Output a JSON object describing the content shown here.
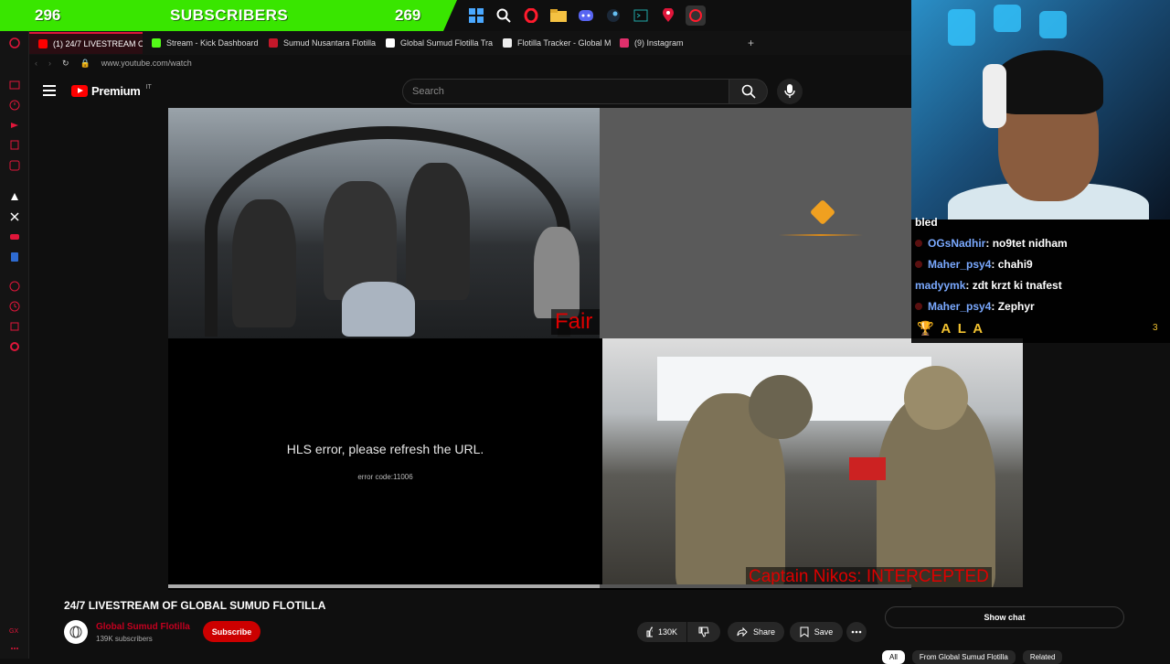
{
  "overlay": {
    "sub_count_left": "296",
    "sub_label": "SUBSCRIBERS",
    "sub_count_right": "269"
  },
  "taskbar_icons": [
    "windows-icon",
    "search-icon",
    "opera-icon",
    "folder-icon",
    "discord-icon",
    "steam-icon",
    "terminal-icon",
    "location-pin-icon",
    "opera-gx-icon"
  ],
  "tabs": [
    {
      "label": "(1) 24/7 LIVESTREAM OF",
      "color": "#ff0000",
      "active": true
    },
    {
      "label": "Stream - Kick Dashboard",
      "color": "#53fc18"
    },
    {
      "label": "Sumud Nusantara Flotilla",
      "color": "#c4182a"
    },
    {
      "label": "Global Sumud Flotilla Tra",
      "color": "#ffffff"
    },
    {
      "label": "Flotilla Tracker - Global M",
      "color": "#ffffff"
    },
    {
      "label": "(9) Instagram",
      "color": "#e1306c"
    }
  ],
  "address": {
    "url": "www.youtube.com/watch"
  },
  "youtube": {
    "logo_text": "Premium",
    "logo_region": "IT",
    "search_placeholder": "Search"
  },
  "player": {
    "cam1_label": "Fair Lady",
    "hls_message": "HLS error, please refresh the URL.",
    "hls_code": "error code:11006",
    "cam2_label": "Captain Nikos: INTERCEPTED",
    "progress": 0.58
  },
  "chat": {
    "partial_line": "bled",
    "messages": [
      {
        "user": "OGsNadhir",
        "text": ": no9tet nidham"
      },
      {
        "user": "Maher_psy4",
        "text": ": chahi9"
      },
      {
        "user": "madyymk",
        "text": ": zdt krzt ki tnafest"
      },
      {
        "user": "Maher_psy4",
        "text": ": Zephyr"
      }
    ],
    "highlight": "A L A",
    "count": "3"
  },
  "video": {
    "title": "24/7 LIVESTREAM OF GLOBAL SUMUD FLOTILLA",
    "channel": "Global Sumud Flotilla",
    "subscribers": "139K subscribers",
    "subscribe_label": "Subscribe",
    "likes": "130K",
    "share_label": "Share",
    "save_label": "Save",
    "show_chat_label": "Show chat",
    "chips": [
      "All",
      "From Global Sumud Flotilla",
      "Related"
    ]
  },
  "colors": {
    "accent_red": "#cc0000",
    "sub_bar_green": "#39e600",
    "chat_user_blue": "#7aa9ff",
    "gold": "#f2c230"
  }
}
